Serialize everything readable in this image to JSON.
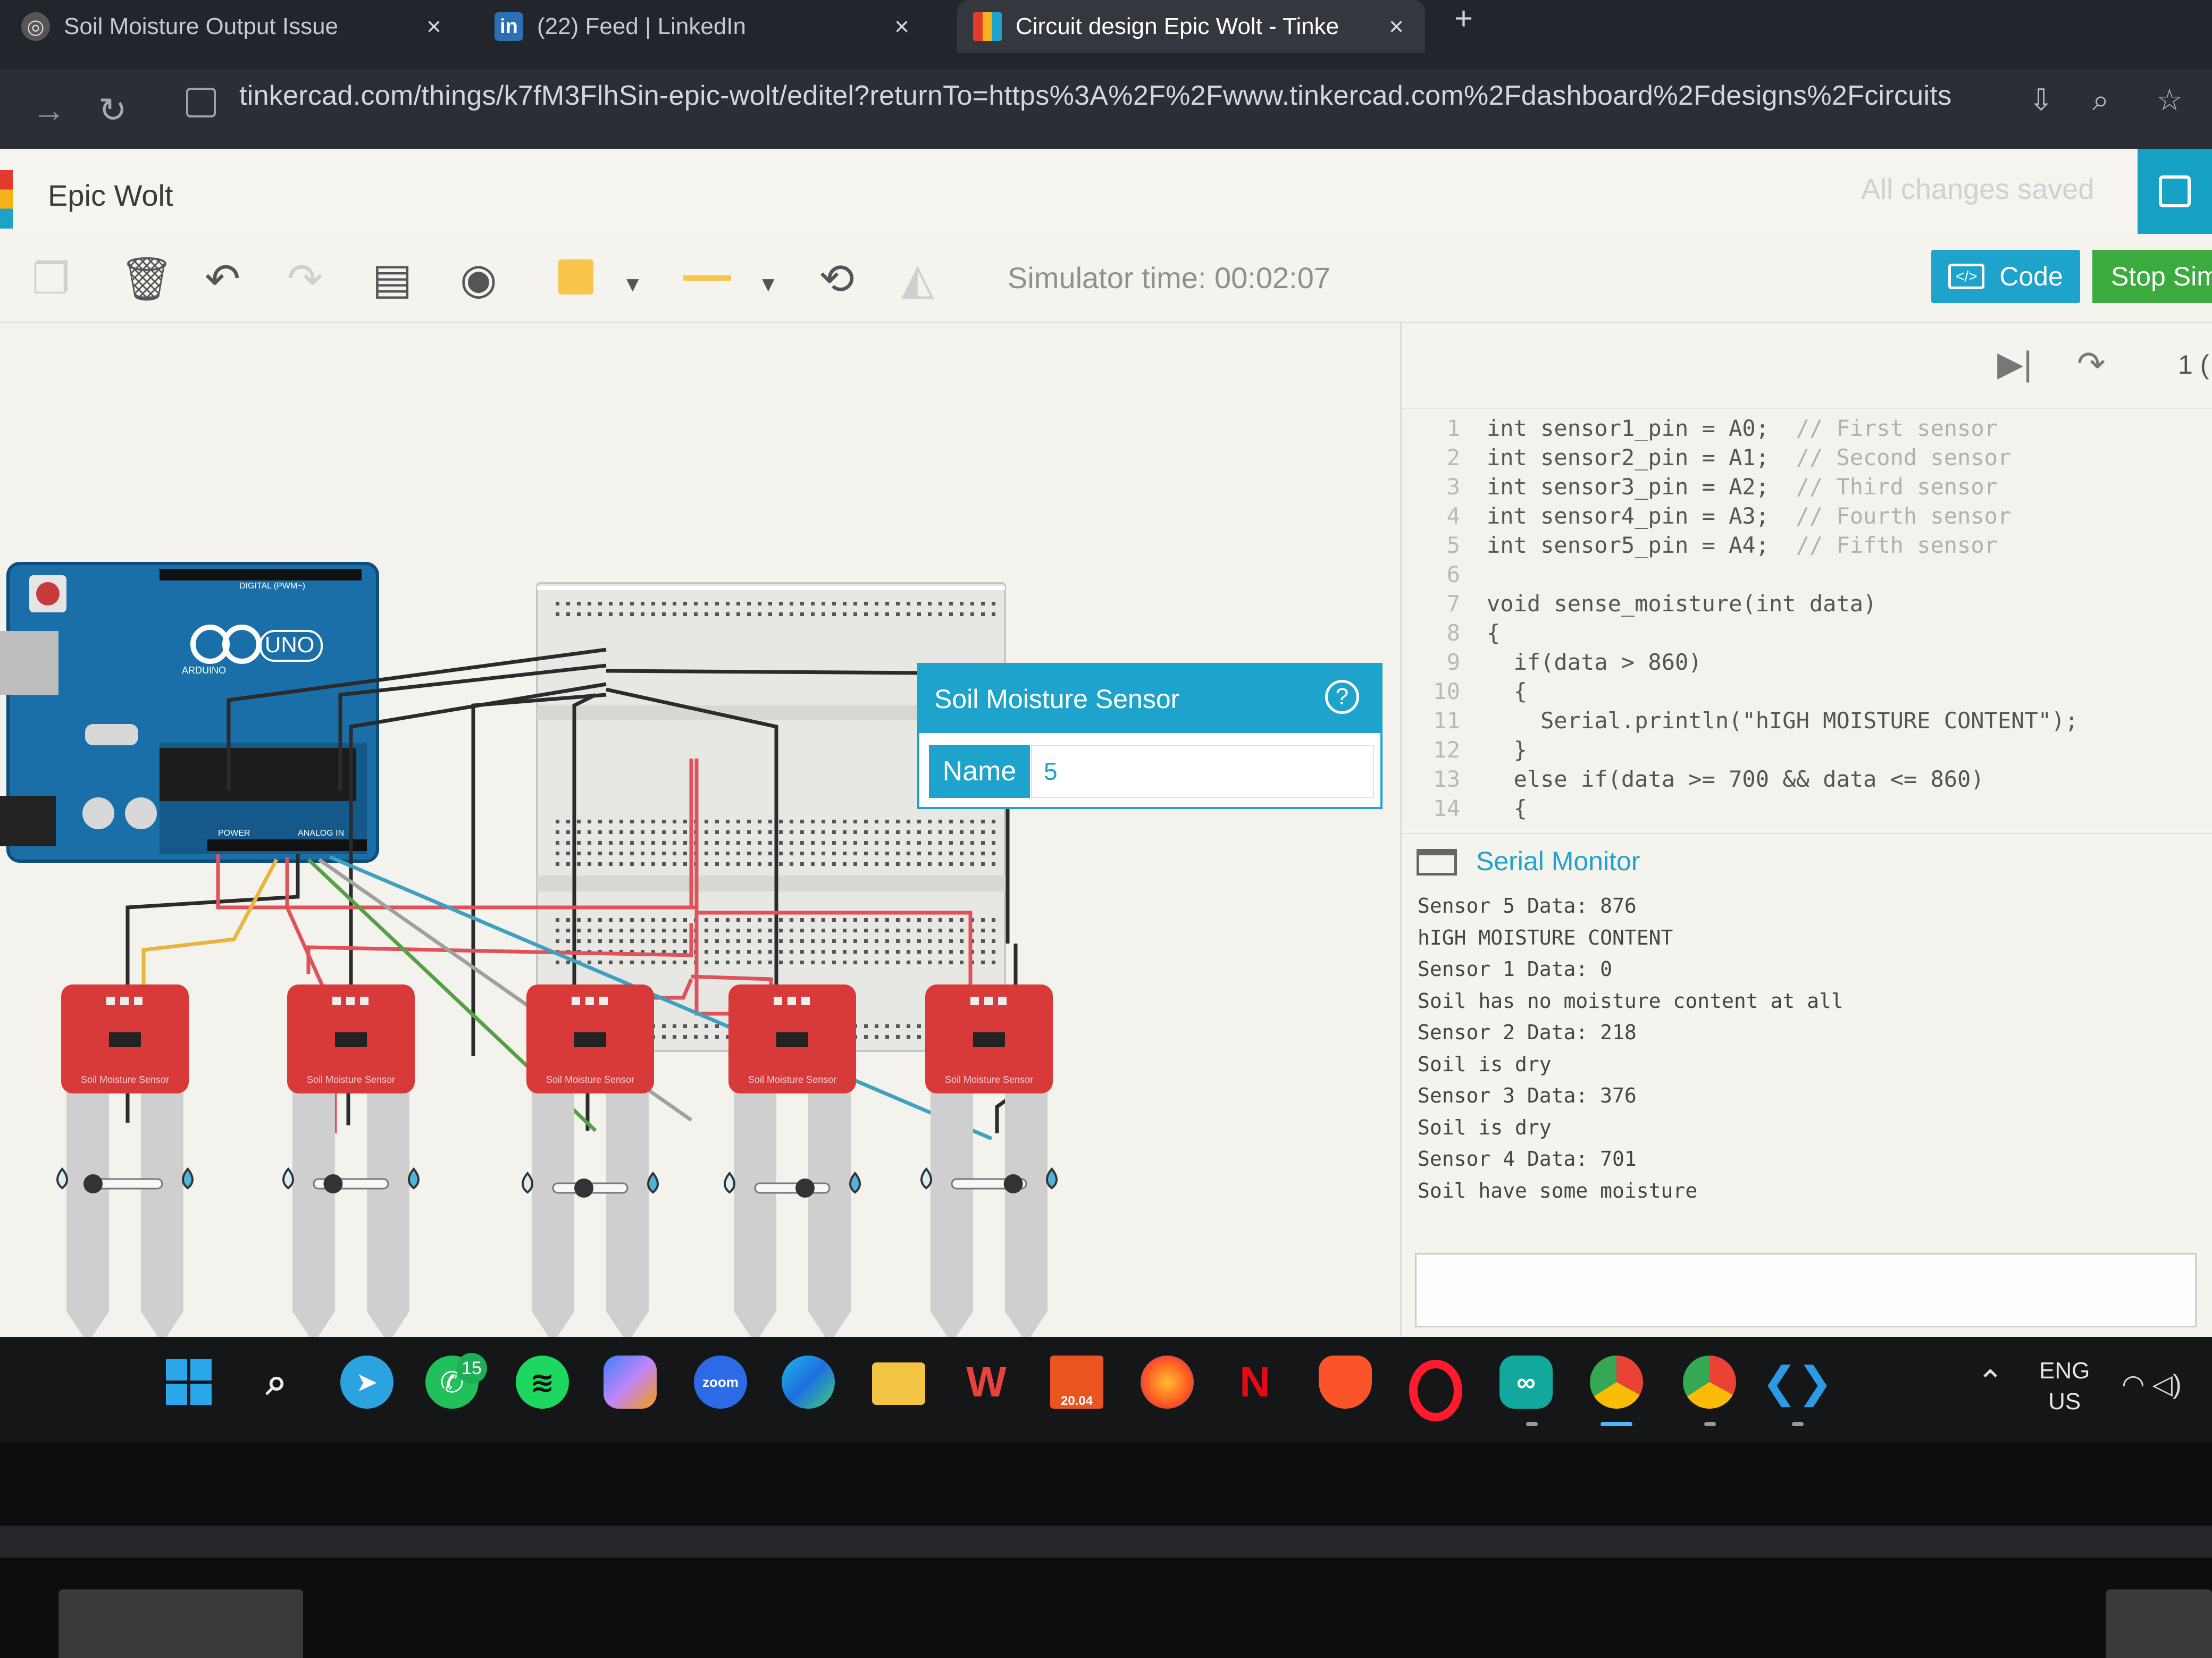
{
  "browser": {
    "tabs": [
      {
        "title": "Soil Moisture Output Issue",
        "close": "×"
      },
      {
        "title": "(22) Feed | LinkedIn",
        "close": "×"
      },
      {
        "title": "Circuit design Epic Wolt - Tinke",
        "close": "×"
      }
    ],
    "new_tab": "+",
    "url": "tinkercad.com/things/k7fM3FlhSin-epic-wolt/editel?returnTo=https%3A%2F%2Fwww.tinkercad.com%2Fdashboard%2Fdesigns%2Fcircuits"
  },
  "app": {
    "design_name": "Epic Wolt",
    "save_status": "All changes saved",
    "simulator_time": "Simulator time: 00:02:07",
    "code_button": "Code",
    "stop_button": "Stop Sim",
    "colors": {
      "accent": "#1ea3cc",
      "stop": "#3cab3f",
      "sensor": "#d83a3a"
    }
  },
  "inspector": {
    "title": "Soil Moisture Sensor",
    "help": "?",
    "name_label": "Name",
    "name_value": "5"
  },
  "circuit": {
    "board_labels": [
      "UNO",
      "ARDUINO",
      "DIGITAL (PWM~)",
      "POWER",
      "ANALOG IN"
    ],
    "sensor_label": "Soil Moisture Sensor",
    "sensor_levels": [
      0.0,
      0.22,
      0.4,
      0.7,
      0.88
    ]
  },
  "code": {
    "line_indicator": "1 (",
    "lines": [
      {
        "n": "1",
        "code": "int sensor1_pin = A0;  ",
        "comment": "// First sensor"
      },
      {
        "n": "2",
        "code": "int sensor2_pin = A1;  ",
        "comment": "// Second sensor"
      },
      {
        "n": "3",
        "code": "int sensor3_pin = A2;  ",
        "comment": "// Third sensor"
      },
      {
        "n": "4",
        "code": "int sensor4_pin = A3;  ",
        "comment": "// Fourth sensor"
      },
      {
        "n": "5",
        "code": "int sensor5_pin = A4;  ",
        "comment": "// Fifth sensor"
      },
      {
        "n": "6",
        "code": "",
        "comment": ""
      },
      {
        "n": "7",
        "code": "void sense_moisture(int data)",
        "comment": ""
      },
      {
        "n": "8",
        "code": "{",
        "comment": ""
      },
      {
        "n": "9",
        "code": "  if(data > 860)",
        "comment": ""
      },
      {
        "n": "10",
        "code": "  {",
        "comment": ""
      },
      {
        "n": "11",
        "code": "    Serial.println(\"hIGH MOISTURE CONTENT\");",
        "comment": ""
      },
      {
        "n": "12",
        "code": "  }",
        "comment": ""
      },
      {
        "n": "13",
        "code": "  else if(data >= 700 && data <= 860)",
        "comment": ""
      },
      {
        "n": "14",
        "code": "  {",
        "comment": ""
      }
    ]
  },
  "serial_monitor": {
    "title": "Serial Monitor",
    "lines": [
      "Sensor 5 Data: 876",
      "hIGH MOISTURE CONTENT",
      "Sensor 1 Data: 0",
      "Soil has no moisture content at all",
      "Sensor 2 Data: 218",
      "Soil is dry",
      "Sensor 3 Data: 376",
      "Soil is dry",
      "Sensor 4 Data: 701",
      "Soil have some moisture"
    ]
  },
  "taskbar": {
    "icons": [
      "windows-icon",
      "search-icon",
      "telegram-icon",
      "whatsapp-icon",
      "spotify-icon",
      "copilot-icon",
      "zoom-icon",
      "edge-icon",
      "file-explorer-icon",
      "wps-icon",
      "ubuntu-icon",
      "firefox-icon",
      "netflix-icon",
      "brave-icon",
      "opera-icon",
      "arduino-icon",
      "chrome-icon",
      "chrome-profile-icon",
      "vscode-icon"
    ],
    "whatsapp_badge": "15",
    "zoom_label": "zoom",
    "ubuntu_label": "20.04",
    "lang_line1": "ENG",
    "lang_line2": "US"
  }
}
